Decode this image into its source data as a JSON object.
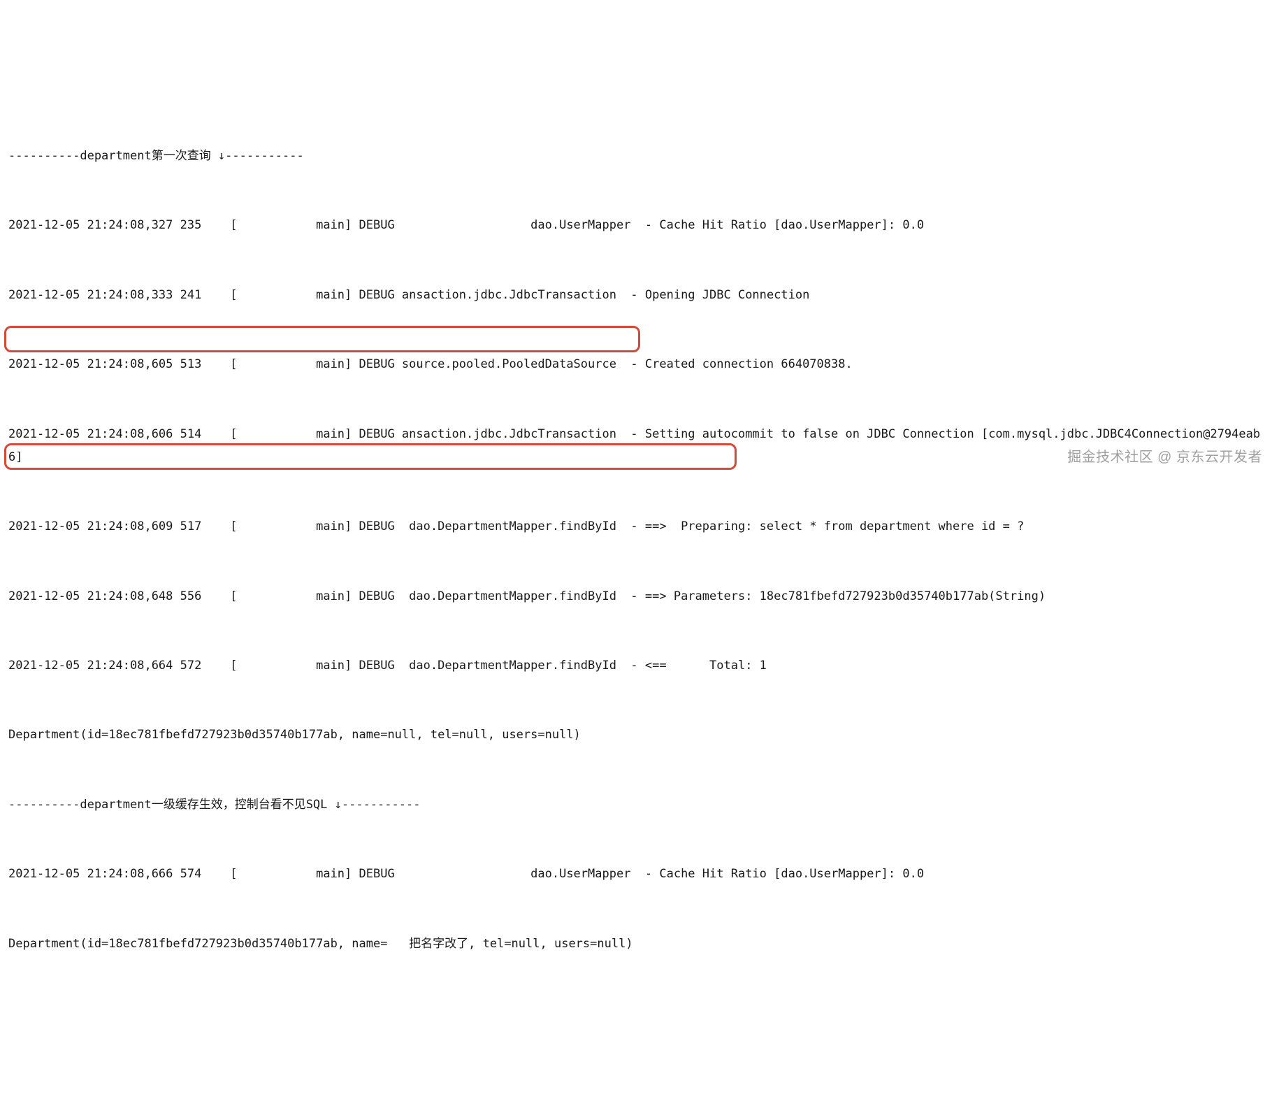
{
  "log": {
    "lines": [
      "----------department第一次查询 ↓-----------",
      "2021-12-05 21:24:08,327 235    [           main] DEBUG                   dao.UserMapper  - Cache Hit Ratio [dao.UserMapper]: 0.0",
      "2021-12-05 21:24:08,333 241    [           main] DEBUG ansaction.jdbc.JdbcTransaction  - Opening JDBC Connection",
      "2021-12-05 21:24:08,605 513    [           main] DEBUG source.pooled.PooledDataSource  - Created connection 664070838.",
      "2021-12-05 21:24:08,606 514    [           main] DEBUG ansaction.jdbc.JdbcTransaction  - Setting autocommit to false on JDBC Connection [com.mysql.jdbc.JDBC4Connection@2794eab6]",
      "2021-12-05 21:24:08,609 517    [           main] DEBUG  dao.DepartmentMapper.findById  - ==>  Preparing: select * from department where id = ?",
      "2021-12-05 21:24:08,648 556    [           main] DEBUG  dao.DepartmentMapper.findById  - ==> Parameters: 18ec781fbefd727923b0d35740b177ab(String)",
      "2021-12-05 21:24:08,664 572    [           main] DEBUG  dao.DepartmentMapper.findById  - <==      Total: 1",
      "Department(id=18ec781fbefd727923b0d35740b177ab, name=null, tel=null, users=null)",
      "----------department一级缓存生效，控制台看不见SQL ↓-----------",
      "2021-12-05 21:24:08,666 574    [           main] DEBUG                   dao.UserMapper  - Cache Hit Ratio [dao.UserMapper]: 0.0",
      "Department(id=18ec781fbefd727923b0d35740b177ab, name=   把名字改了, tel=null, users=null)"
    ]
  },
  "watermark": "掘金技术社区 @ 京东云开发者"
}
